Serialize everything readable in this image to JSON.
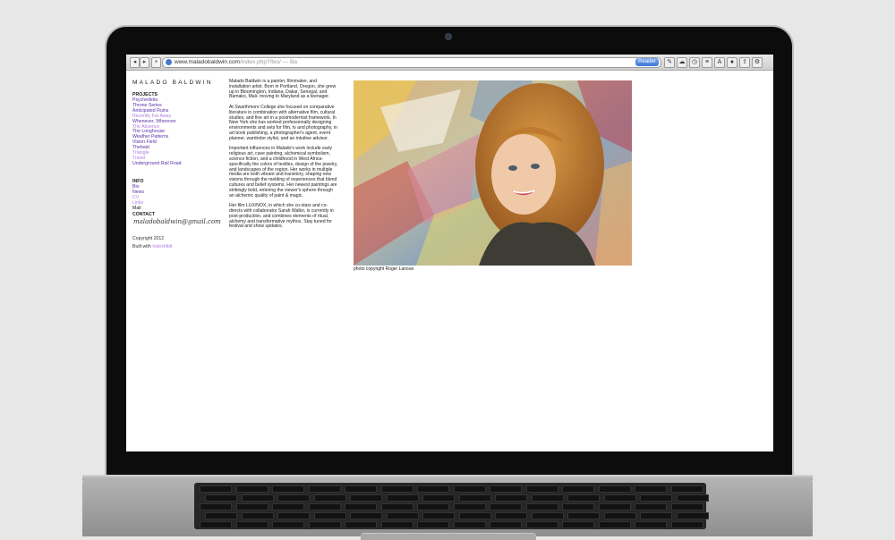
{
  "browser": {
    "url_domain": "www.maladobaldwin.com",
    "url_path": "/index.php?/bio/ — Ba",
    "reader_label": "Reader",
    "back_label": "◂",
    "forward_label": "▸",
    "add_label": "+"
  },
  "site": {
    "name": "MALADO BALDWIN",
    "projects_heading": "PROJECTS",
    "projects": [
      "Psychedelia",
      "Throne Series",
      "Anticipated Ruins",
      "Recently Far Away",
      "Whenever, Wherever",
      "The Absence",
      "The Longhouse",
      "Weather Patterns",
      "Vision Field",
      "Thebaid",
      "Triangle",
      "Travel",
      "Underground Rail Road"
    ],
    "info_heading": "INFO",
    "info_links": [
      "Bio",
      "News",
      "CV",
      "Links",
      "Mail"
    ],
    "contact_heading": "CONTACT",
    "contact_email": "maladobaldwin@gmail.com",
    "copyright": "Copyright 2012",
    "built_with_prefix": "Built with",
    "built_with_link": "Indexhibit"
  },
  "bio": {
    "paragraphs": [
      "Malado Baldwin is a painter, filmmaker, and installation artist. Born in Portland, Oregon, she grew up in Bloomington, Indiana, Dakar, Senegal, and Bamako, Mali- moving to Maryland as a teenager.",
      "At Swarthmore College she focused on comparative literature in combination with alternative film, cultural studies, and fine art in a postmodernist framework. In New York she has worked professionally designing environments and sets for film, tv and photography, in art book publishing, a photographer's agent, event planner, wardrobe stylist, and an intuitive advisor.",
      "Important influences in Malado's work include early religious art, cave painting, alchemical symbolism, science fiction, and a childhood in West Africa- specifically the colors of textiles, design of the jewelry, and landscapes of the region. Her works in multiple media are both vibrant and transitory, shaping new visions through the melding of experiences that blend cultures and belief systems. Her newest paintings are strikingly bold, entering the viewer's sphere through an alchemic quality of paint & magic.",
      "Her film LUX/NOX, in which she co-stars and co-directs with collaborator Sarah Walko, is currently in post-production, and combines elements of ritual, alchemy and transformative mythos. Stay tuned for festival and show updates."
    ]
  },
  "photo": {
    "caption": "photo copyright Roger Lanoue"
  },
  "colors": {
    "link": "#5a2ea6",
    "visited_link": "#b07fe0",
    "reader_button": "#3f74d6"
  }
}
